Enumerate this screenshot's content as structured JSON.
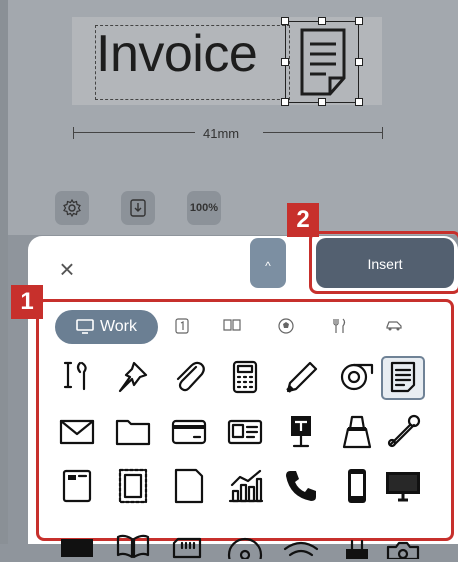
{
  "label": {
    "text": "Invoice",
    "width_text": "41mm"
  },
  "toolbar": {
    "zoom_label": "100%"
  },
  "panel": {
    "insert_label": "Insert",
    "collapse_label": "^",
    "close_label": "×"
  },
  "callouts": {
    "badge_1": "1",
    "badge_2": "2"
  },
  "tabs": [
    {
      "label": "Work",
      "icon": "monitor-icon",
      "selected": true
    },
    {
      "icon": "number-one-icon"
    },
    {
      "icon": "book-icon"
    },
    {
      "icon": "soccer-ball-icon"
    },
    {
      "icon": "cutlery-icon"
    },
    {
      "icon": "car-icon"
    }
  ],
  "icons": [
    [
      "tools-icon",
      "pushpin-icon",
      "paperclip-icon",
      "calculator-icon",
      "pen-icon",
      "tape-icon",
      "document-icon"
    ],
    [
      "envelope-icon",
      "folder-icon",
      "credit-card-icon",
      "id-card-icon",
      "mailbox-icon",
      "binder-clip-icon",
      "safety-pin-icon"
    ],
    [
      "fax-icon",
      "stamp-icon",
      "file-icon",
      "chart-icon",
      "phone-icon",
      "smartphone-icon",
      "monitor-icon"
    ],
    [
      "printer-icon",
      "book-icon",
      "sd-card-icon",
      "cd-icon",
      "wifi-icon",
      "plug-icon",
      "camera-icon"
    ]
  ],
  "colors": {
    "accent": "#c7302c",
    "insert_button": "#536070",
    "tab_selected": "#6b7f93"
  }
}
